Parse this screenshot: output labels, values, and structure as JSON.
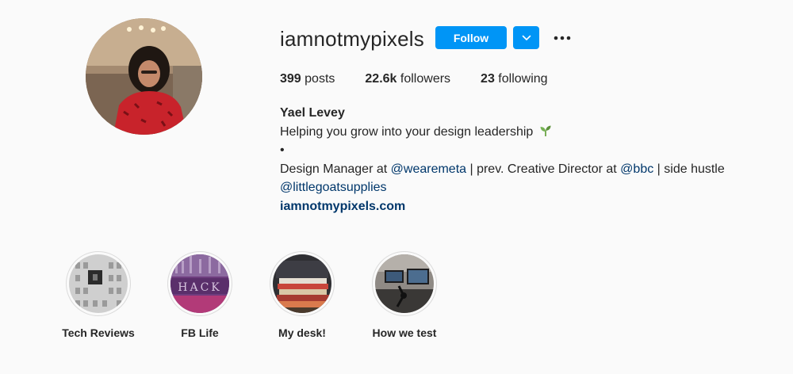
{
  "profile": {
    "username": "iamnotmypixels",
    "follow_label": "Follow",
    "stats": {
      "posts_count": "399",
      "posts_label": "posts",
      "followers_count": "22.6k",
      "followers_label": "followers",
      "following_count": "23",
      "following_label": "following"
    },
    "bio": {
      "name": "Yael Levey",
      "tagline": "Helping you grow into your design leadership",
      "tagline_emoji": "seedling-icon",
      "bullet": "•",
      "line1_pre": "Design Manager at ",
      "mention1": "@wearemeta",
      "line1_mid": " | prev. Creative Director at ",
      "mention2": "@bbc",
      "line1_post": " | side hustle",
      "mention3": "@littlegoatsupplies",
      "website": "iamnotmypixels.com"
    }
  },
  "highlights": [
    {
      "label": "Tech Reviews"
    },
    {
      "label": "FB Life"
    },
    {
      "label": "My desk!"
    },
    {
      "label": "How we test"
    }
  ],
  "colors": {
    "accent": "#0095f6",
    "link": "#00376b",
    "background": "#fafafa",
    "text": "#262626"
  }
}
